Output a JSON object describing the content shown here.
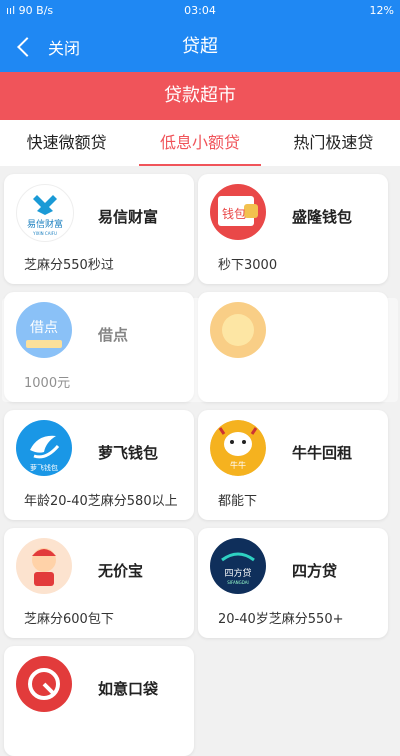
{
  "status_bar": {
    "signal": "ııl",
    "speed": "90 B/s",
    "time": "03:04",
    "battery": "12%"
  },
  "nav": {
    "back_label": "关闭",
    "title": "贷超"
  },
  "banner": {
    "title": "贷款超市"
  },
  "tabs": [
    {
      "label": "快速微额贷",
      "active": false
    },
    {
      "label": "低息小额贷",
      "active": true
    },
    {
      "label": "热门极速贷",
      "active": false
    }
  ],
  "cards": [
    {
      "name": "易信财富",
      "desc": "芝麻分550秒过",
      "logo": "yixin-logo",
      "logo_text": "易信财富",
      "logo_subtext": "YIXIN CAIFU"
    },
    {
      "name": "盛隆钱包",
      "desc": "秒下3000",
      "logo": "shenglong-logo",
      "logo_text": "钱包"
    },
    {
      "name": "借点",
      "desc": "1000元",
      "logo": "jiedian-logo",
      "logo_text": "借点"
    },
    {
      "name": "",
      "desc": "",
      "logo": "orange-logo",
      "logo_text": ""
    },
    {
      "name": "萝飞钱包",
      "desc": "年龄20-40芝麻分580以上",
      "logo": "luofei-logo",
      "logo_text": "萝飞钱包"
    },
    {
      "name": "牛牛回租",
      "desc": "都能下",
      "logo": "niuniu-logo",
      "logo_text": "牛牛"
    },
    {
      "name": "无价宝",
      "desc": "芝麻分600包下",
      "logo": "wujiabao-logo",
      "logo_text": ""
    },
    {
      "name": "四方贷",
      "desc": "20-40岁芝麻分550+",
      "logo": "sifang-logo",
      "logo_text": "四方贷",
      "logo_subtext": "SIFANGDAI"
    },
    {
      "name": "如意口袋",
      "desc": "",
      "logo": "ruyi-logo",
      "logo_text": ""
    }
  ],
  "colors": {
    "primary": "#1f88f3",
    "accent": "#f0545a",
    "background": "#f1f1f1"
  }
}
